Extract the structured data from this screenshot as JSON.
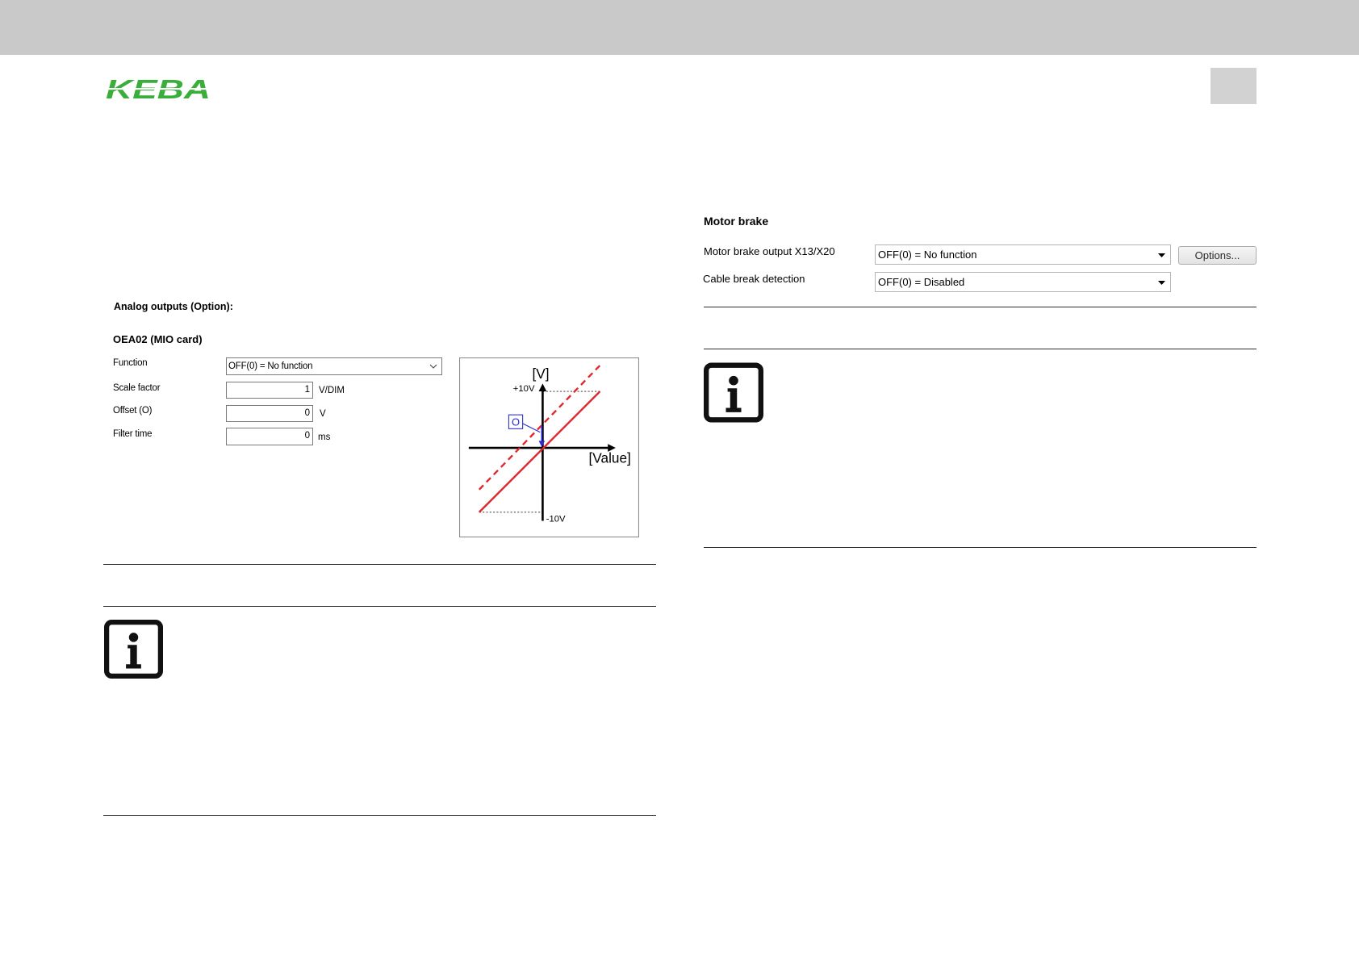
{
  "header": {
    "logo_text": "KEBA"
  },
  "analog_outputs": {
    "section_title": "Analog outputs (Option):",
    "group_title": "OEA02 (MIO card)",
    "function": {
      "label": "Function",
      "value": "OFF(0) = No function"
    },
    "scale_factor": {
      "label": "Scale factor",
      "value": "1",
      "unit": "V/DIM"
    },
    "offset": {
      "label": "Offset (O)",
      "value": "0",
      "unit": "V"
    },
    "filter_time": {
      "label": "Filter time",
      "value": "0",
      "unit": "ms"
    },
    "diagram": {
      "y_axis_label": "[V]",
      "x_axis_label": "[Value]",
      "y_max_label": "+10V",
      "y_min_label": "-10V",
      "offset_label": "O"
    }
  },
  "motor_brake": {
    "section_title": "Motor brake",
    "brake_output": {
      "label": "Motor brake output X13/X20",
      "value": "OFF(0) = No function"
    },
    "cable_break": {
      "label": "Cable break detection",
      "value": "OFF(0) = Disabled"
    },
    "options_button": "Options..."
  },
  "icons": {
    "note": "info-icon",
    "dropdown": "chevron-down-icon",
    "combo_dropdown": "caret-down-icon"
  },
  "colors": {
    "brand_green": "#3aae3a",
    "header_bar": "#c9c9c9",
    "characteristic_line": "#e3262b",
    "offset_marker": "#2b2bd6"
  }
}
